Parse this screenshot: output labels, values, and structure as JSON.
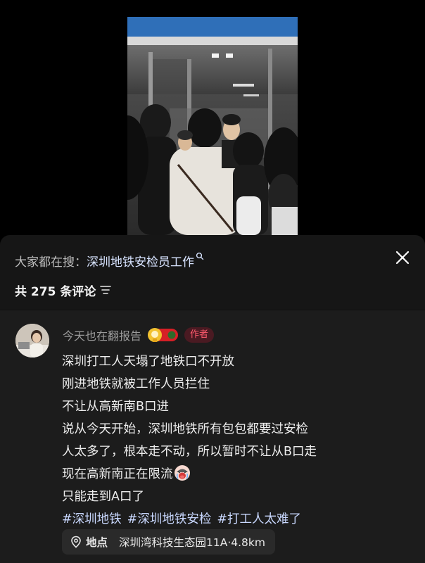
{
  "search": {
    "prefix": "大家都在搜：",
    "term": "深圳地铁安检员工作"
  },
  "comments_header": {
    "count_text": "共 275 条评论"
  },
  "comment": {
    "username": "今天也在翻报告",
    "author_tag": "作者",
    "lines": [
      "深圳打工人天塌了地铁口不开放",
      "刚进地铁就被工作人员拦住",
      "不让从高新南B口进",
      "说从今天开始，深圳地铁所有包包都要过安检",
      "人太多了，根本走不动，所以暂时不让从B口走",
      "现在高新南正在限流",
      "只能走到A口了"
    ],
    "hashtags": [
      "#深圳地铁",
      "#深圳地铁安检",
      "#打工人太难了"
    ],
    "location": {
      "label": "地点",
      "place": "深圳湾科技生态园11A·4.8km"
    }
  },
  "icons": {
    "search": "search-icon",
    "close": "close-icon",
    "sort": "sort-icon",
    "pin": "location-pin-icon",
    "emoji": "crying-face-emoji",
    "badge": "fan-badge-icon"
  },
  "colors": {
    "author_tag": "#ff5a6e",
    "hashtag": "#c9d8ff",
    "search_term": "#d7e3ff"
  }
}
